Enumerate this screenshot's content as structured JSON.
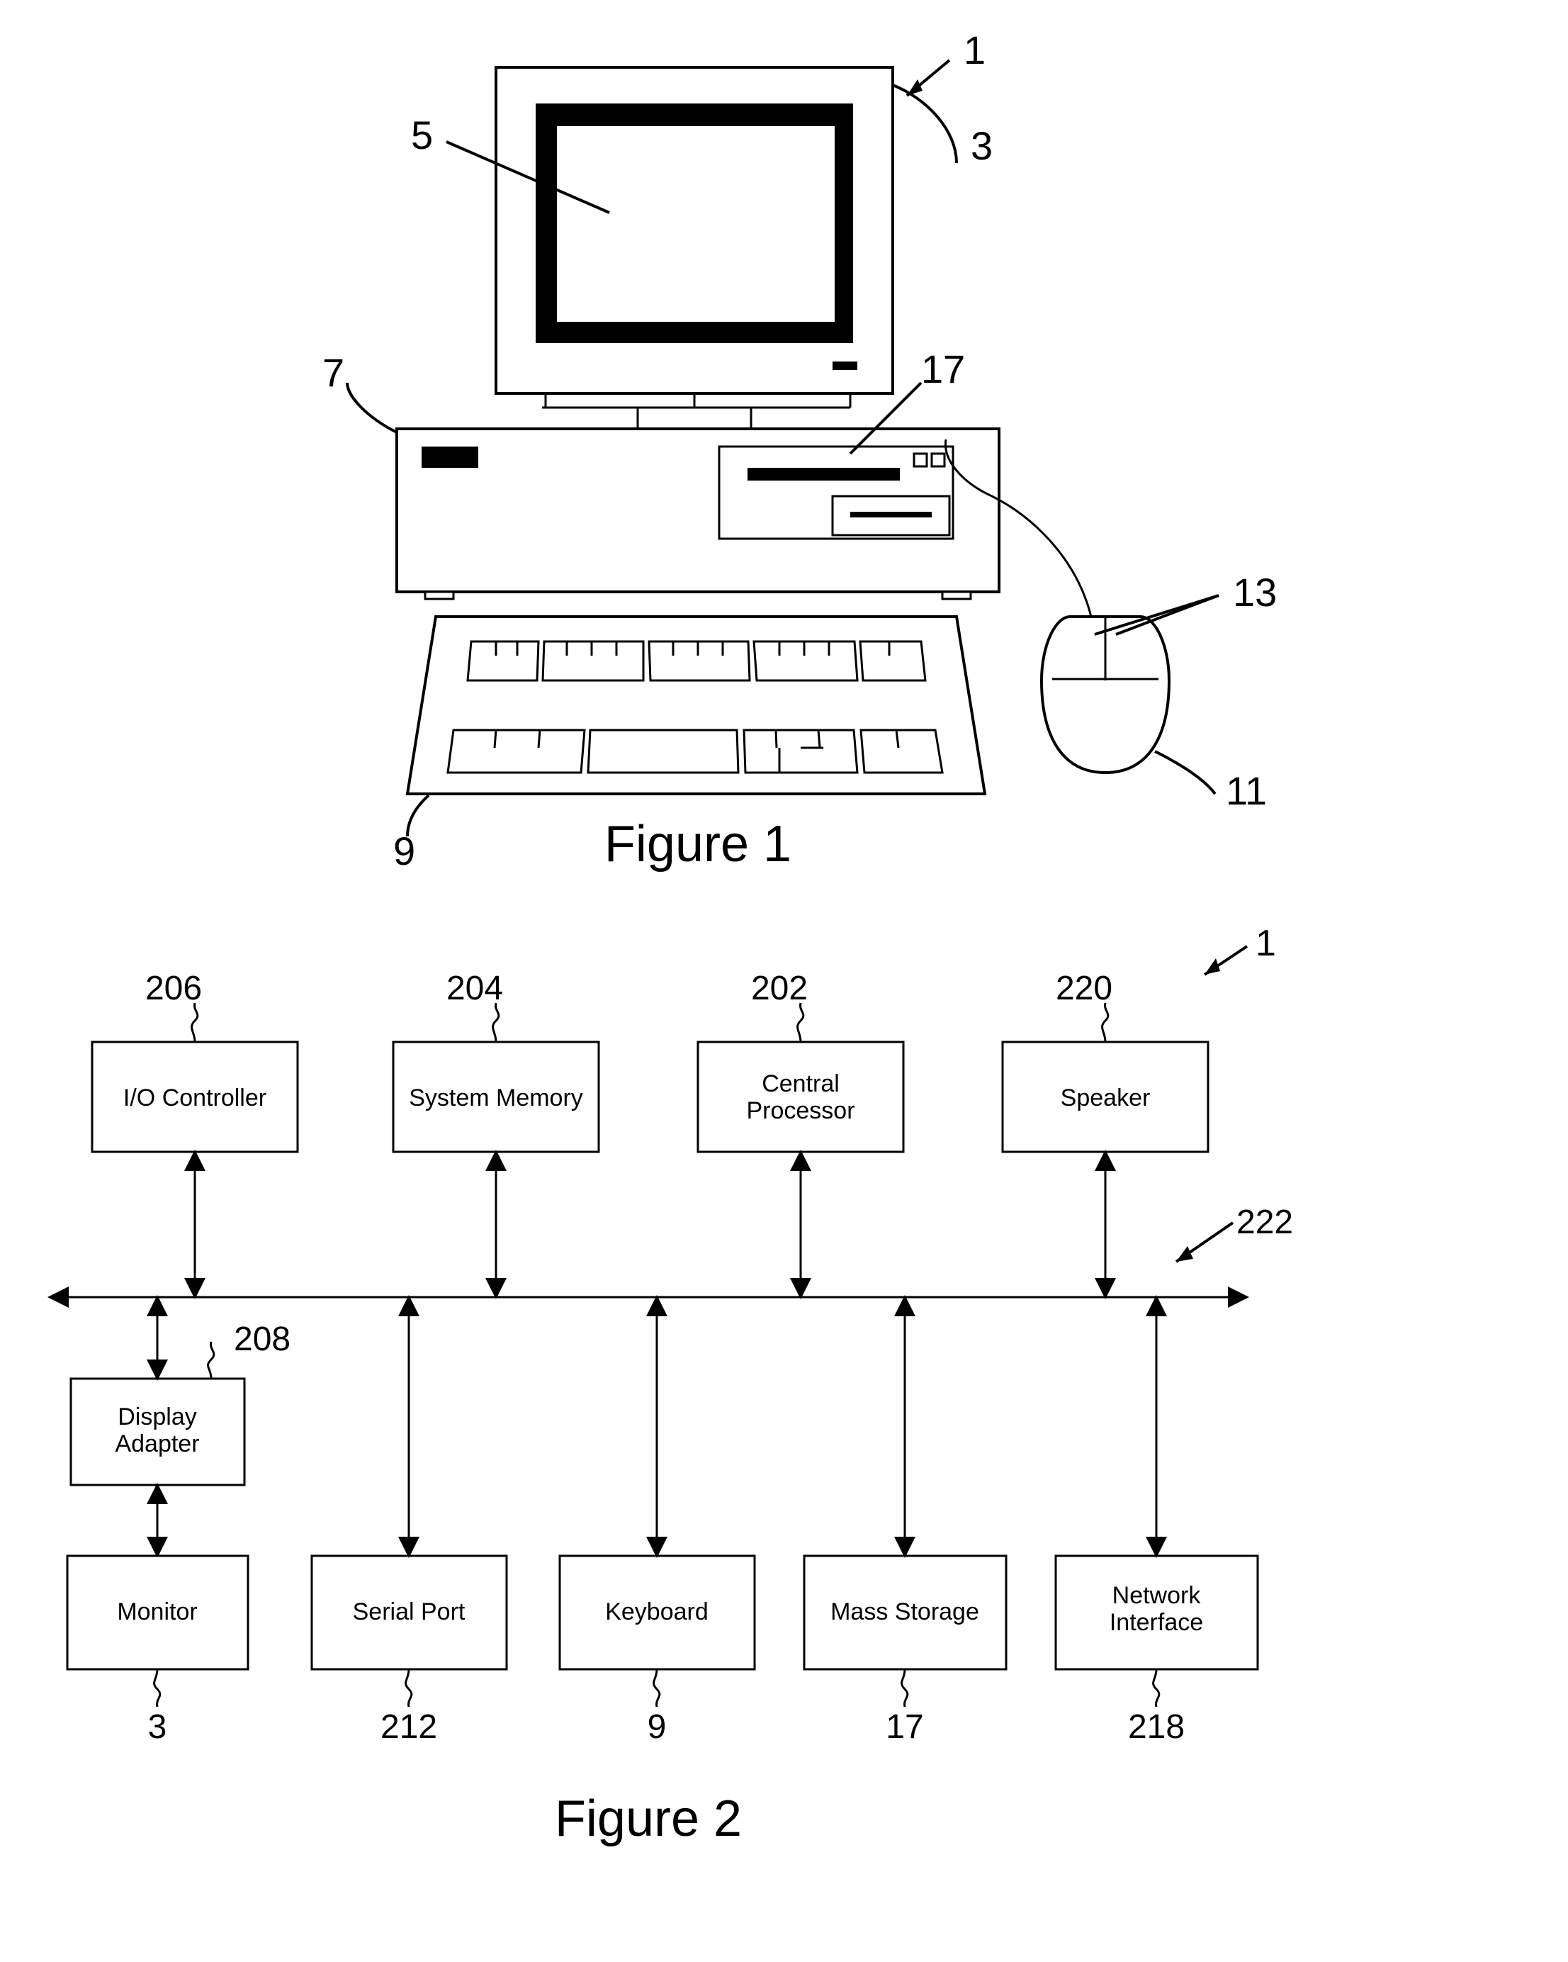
{
  "figure1": {
    "caption": "Figure 1",
    "labels": {
      "system": "1",
      "monitor_unit": "3",
      "screen": "5",
      "tower": "7",
      "keyboard": "9",
      "mouse": "11",
      "mouse_buttons": "13",
      "drive": "17"
    }
  },
  "figure2": {
    "caption": "Figure 2",
    "labels": {
      "system": "1",
      "bus": "222"
    },
    "blocks": {
      "io_controller": {
        "text": "I/O Controller",
        "ref": "206"
      },
      "system_memory": {
        "text": "System Memory",
        "ref": "204"
      },
      "central_processor": {
        "text": "Central\nProcessor",
        "ref": "202"
      },
      "speaker": {
        "text": "Speaker",
        "ref": "220"
      },
      "display_adapter": {
        "text": "Display\nAdapter",
        "ref": "208"
      },
      "monitor": {
        "text": "Monitor",
        "ref": "3"
      },
      "serial_port": {
        "text": "Serial Port",
        "ref": "212"
      },
      "keyboard": {
        "text": "Keyboard",
        "ref": "9"
      },
      "mass_storage": {
        "text": "Mass Storage",
        "ref": "17"
      },
      "network_interface": {
        "text": "Network\nInterface",
        "ref": "218"
      }
    }
  }
}
